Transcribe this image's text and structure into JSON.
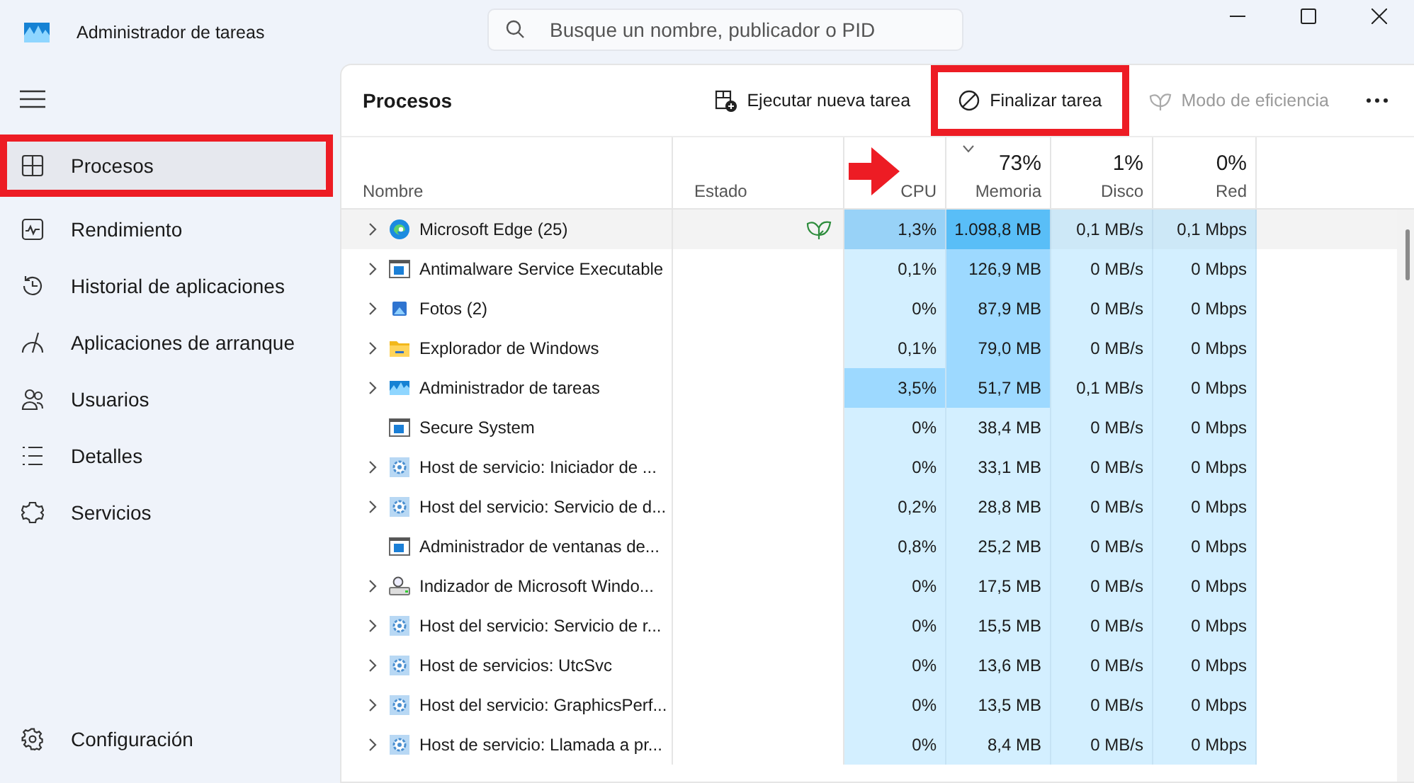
{
  "window": {
    "title": "Administrador de tareas"
  },
  "search": {
    "placeholder": "Busque un nombre, publicador o PID"
  },
  "sidebar": {
    "items": [
      {
        "label": "Procesos",
        "selected": true,
        "annotated": true
      },
      {
        "label": "Rendimiento",
        "selected": false,
        "annotated": false
      },
      {
        "label": "Historial de aplicaciones",
        "selected": false,
        "annotated": false
      },
      {
        "label": "Aplicaciones de arranque",
        "selected": false,
        "annotated": false
      },
      {
        "label": "Usuarios",
        "selected": false,
        "annotated": false
      },
      {
        "label": "Detalles",
        "selected": false,
        "annotated": false
      },
      {
        "label": "Servicios",
        "selected": false,
        "annotated": false
      }
    ],
    "footer": {
      "label": "Configuración"
    }
  },
  "page": {
    "title": "Procesos"
  },
  "toolbar": [
    {
      "label": "Ejecutar nueva tarea",
      "disabled": false,
      "annotated": false
    },
    {
      "label": "Finalizar tarea",
      "disabled": false,
      "annotated": true
    },
    {
      "label": "Modo de eficiencia",
      "disabled": true,
      "annotated": false
    }
  ],
  "table": {
    "columns": [
      {
        "label": "Nombre",
        "sorted": false
      },
      {
        "label": "Estado",
        "sorted": false
      },
      {
        "label": "CPU",
        "sorted": false
      },
      {
        "value": "73%",
        "label": "Memoria",
        "sorted": true
      },
      {
        "value": "1%",
        "label": "Disco",
        "sorted": false
      },
      {
        "value": "0%",
        "label": "Red",
        "sorted": false
      }
    ],
    "rows": [
      {
        "kind": "edge",
        "expandable": true,
        "efficiency_mode": true,
        "selected": true,
        "cells": [
          {
            "text": "Microsoft Edge (25)"
          },
          {
            "text": ""
          },
          {
            "text": "1,3%",
            "color": "#9dd9ff"
          },
          {
            "text": "1.098,8 MB",
            "color": "#5cc4ff"
          },
          {
            "text": "0,1 MB/s",
            "color": "#d3efff"
          },
          {
            "text": "0,1 Mbps",
            "color": "#d3efff"
          }
        ]
      },
      {
        "kind": "window",
        "expandable": true,
        "efficiency_mode": false,
        "selected": false,
        "cells": [
          {
            "text": "Antimalware Service Executable"
          },
          {
            "text": ""
          },
          {
            "text": "0,1%",
            "color": "#d3efff"
          },
          {
            "text": "126,9 MB",
            "color": "#9dd9ff"
          },
          {
            "text": "0 MB/s",
            "color": "#d3efff"
          },
          {
            "text": "0 Mbps",
            "color": "#d3efff"
          }
        ]
      },
      {
        "kind": "photos",
        "expandable": true,
        "efficiency_mode": false,
        "selected": false,
        "cells": [
          {
            "text": "Fotos (2)"
          },
          {
            "text": ""
          },
          {
            "text": "0%",
            "color": "#d3efff"
          },
          {
            "text": "87,9 MB",
            "color": "#9dd9ff"
          },
          {
            "text": "0 MB/s",
            "color": "#d3efff"
          },
          {
            "text": "0 Mbps",
            "color": "#d3efff"
          }
        ]
      },
      {
        "kind": "folder",
        "expandable": true,
        "efficiency_mode": false,
        "selected": false,
        "cells": [
          {
            "text": "Explorador de Windows"
          },
          {
            "text": ""
          },
          {
            "text": "0,1%",
            "color": "#d3efff"
          },
          {
            "text": "79,0 MB",
            "color": "#9dd9ff"
          },
          {
            "text": "0 MB/s",
            "color": "#d3efff"
          },
          {
            "text": "0 Mbps",
            "color": "#d3efff"
          }
        ]
      },
      {
        "kind": "taskmgr",
        "expandable": true,
        "efficiency_mode": false,
        "selected": false,
        "cells": [
          {
            "text": "Administrador de tareas"
          },
          {
            "text": ""
          },
          {
            "text": "3,5%",
            "color": "#9dd9ff"
          },
          {
            "text": "51,7 MB",
            "color": "#9dd9ff"
          },
          {
            "text": "0,1 MB/s",
            "color": "#d3efff"
          },
          {
            "text": "0 Mbps",
            "color": "#d3efff"
          }
        ]
      },
      {
        "kind": "window",
        "expandable": false,
        "efficiency_mode": false,
        "selected": false,
        "cells": [
          {
            "text": "Secure System"
          },
          {
            "text": ""
          },
          {
            "text": "0%",
            "color": "#d3efff"
          },
          {
            "text": "38,4 MB",
            "color": "#d3efff"
          },
          {
            "text": "0 MB/s",
            "color": "#d3efff"
          },
          {
            "text": "0 Mbps",
            "color": "#d3efff"
          }
        ]
      },
      {
        "kind": "gear",
        "expandable": true,
        "efficiency_mode": false,
        "selected": false,
        "cells": [
          {
            "text": "Host de servicio: Iniciador de ..."
          },
          {
            "text": ""
          },
          {
            "text": "0%",
            "color": "#d3efff"
          },
          {
            "text": "33,1 MB",
            "color": "#d3efff"
          },
          {
            "text": "0 MB/s",
            "color": "#d3efff"
          },
          {
            "text": "0 Mbps",
            "color": "#d3efff"
          }
        ]
      },
      {
        "kind": "gear",
        "expandable": true,
        "efficiency_mode": false,
        "selected": false,
        "cells": [
          {
            "text": "Host del servicio: Servicio de d..."
          },
          {
            "text": ""
          },
          {
            "text": "0,2%",
            "color": "#d3efff"
          },
          {
            "text": "28,8 MB",
            "color": "#d3efff"
          },
          {
            "text": "0 MB/s",
            "color": "#d3efff"
          },
          {
            "text": "0 Mbps",
            "color": "#d3efff"
          }
        ]
      },
      {
        "kind": "window",
        "expandable": false,
        "efficiency_mode": false,
        "selected": false,
        "cells": [
          {
            "text": "Administrador de ventanas de..."
          },
          {
            "text": ""
          },
          {
            "text": "0,8%",
            "color": "#d3efff"
          },
          {
            "text": "25,2 MB",
            "color": "#d3efff"
          },
          {
            "text": "0 MB/s",
            "color": "#d3efff"
          },
          {
            "text": "0 Mbps",
            "color": "#d3efff"
          }
        ]
      },
      {
        "kind": "indexer",
        "expandable": true,
        "efficiency_mode": false,
        "selected": false,
        "cells": [
          {
            "text": "Indizador de Microsoft Windo..."
          },
          {
            "text": ""
          },
          {
            "text": "0%",
            "color": "#d3efff"
          },
          {
            "text": "17,5 MB",
            "color": "#d3efff"
          },
          {
            "text": "0 MB/s",
            "color": "#d3efff"
          },
          {
            "text": "0 Mbps",
            "color": "#d3efff"
          }
        ]
      },
      {
        "kind": "gear",
        "expandable": true,
        "efficiency_mode": false,
        "selected": false,
        "cells": [
          {
            "text": "Host del servicio: Servicio de r..."
          },
          {
            "text": ""
          },
          {
            "text": "0%",
            "color": "#d3efff"
          },
          {
            "text": "15,5 MB",
            "color": "#d3efff"
          },
          {
            "text": "0 MB/s",
            "color": "#d3efff"
          },
          {
            "text": "0 Mbps",
            "color": "#d3efff"
          }
        ]
      },
      {
        "kind": "gear",
        "expandable": true,
        "efficiency_mode": false,
        "selected": false,
        "cells": [
          {
            "text": "Host de servicios: UtcSvc"
          },
          {
            "text": ""
          },
          {
            "text": "0%",
            "color": "#d3efff"
          },
          {
            "text": "13,6 MB",
            "color": "#d3efff"
          },
          {
            "text": "0 MB/s",
            "color": "#d3efff"
          },
          {
            "text": "0 Mbps",
            "color": "#d3efff"
          }
        ]
      },
      {
        "kind": "gear",
        "expandable": true,
        "efficiency_mode": false,
        "selected": false,
        "cells": [
          {
            "text": "Host del servicio: GraphicsPerf..."
          },
          {
            "text": ""
          },
          {
            "text": "0%",
            "color": "#d3efff"
          },
          {
            "text": "13,5 MB",
            "color": "#d3efff"
          },
          {
            "text": "0 MB/s",
            "color": "#d3efff"
          },
          {
            "text": "0 Mbps",
            "color": "#d3efff"
          }
        ]
      },
      {
        "kind": "gear",
        "expandable": true,
        "efficiency_mode": false,
        "selected": false,
        "cells": [
          {
            "text": "Host de servicio: Llamada a pr..."
          },
          {
            "text": ""
          },
          {
            "text": "0%",
            "color": "#d3efff"
          },
          {
            "text": "8,4 MB",
            "color": "#d3efff"
          },
          {
            "text": "0 MB/s",
            "color": "#d3efff"
          },
          {
            "text": "0 Mbps",
            "color": "#d3efff"
          }
        ]
      }
    ]
  }
}
